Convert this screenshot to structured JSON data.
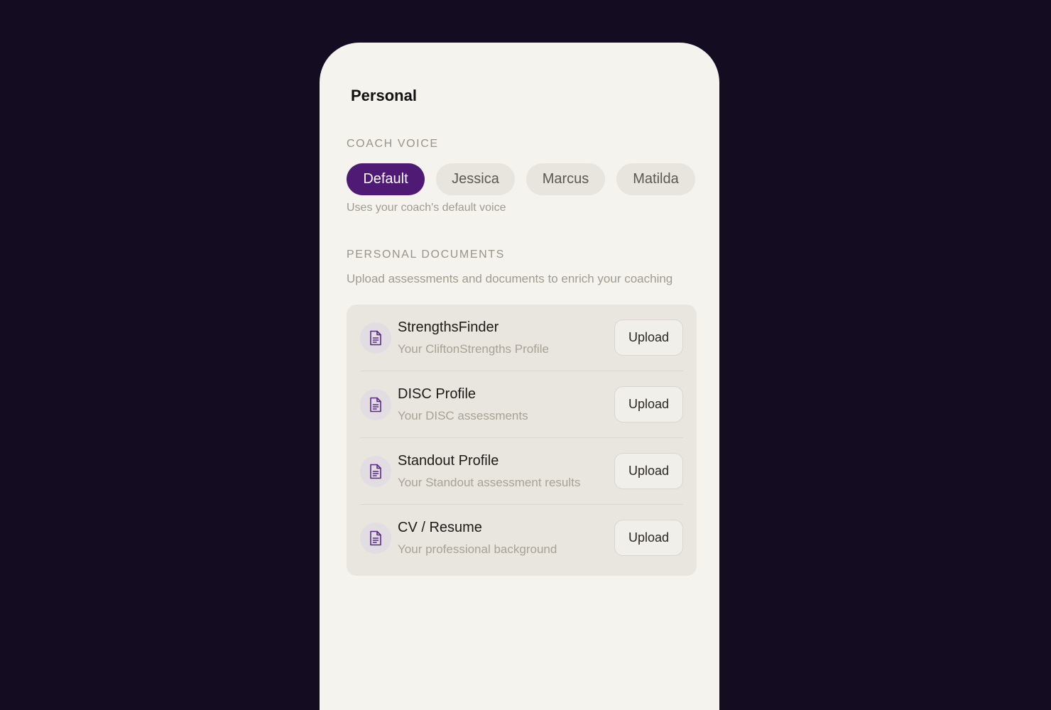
{
  "page": {
    "title": "Personal"
  },
  "coach_voice": {
    "label": "COACH VOICE",
    "options": [
      "Default",
      "Jessica",
      "Marcus",
      "Matilda"
    ],
    "selected": "Default",
    "hint": "Uses your coach's default voice"
  },
  "personal_documents": {
    "label": "PERSONAL DOCUMENTS",
    "description": "Upload assessments and documents to enrich your coaching",
    "items": [
      {
        "title": "StrengthsFinder",
        "subtitle": "Your CliftonStrengths Profile",
        "action": "Upload",
        "icon": "document-icon"
      },
      {
        "title": "DISC Profile",
        "subtitle": "Your DISC assessments",
        "action": "Upload",
        "icon": "document-icon"
      },
      {
        "title": "Standout Profile",
        "subtitle": "Your Standout assessment results",
        "action": "Upload",
        "icon": "document-icon"
      },
      {
        "title": "CV / Resume",
        "subtitle": "Your professional background",
        "action": "Upload",
        "icon": "document-icon"
      }
    ]
  },
  "colors": {
    "background": "#140d22",
    "panel": "#f4f3ee",
    "accent": "#4f1a73",
    "icon": "#5b2a86"
  }
}
